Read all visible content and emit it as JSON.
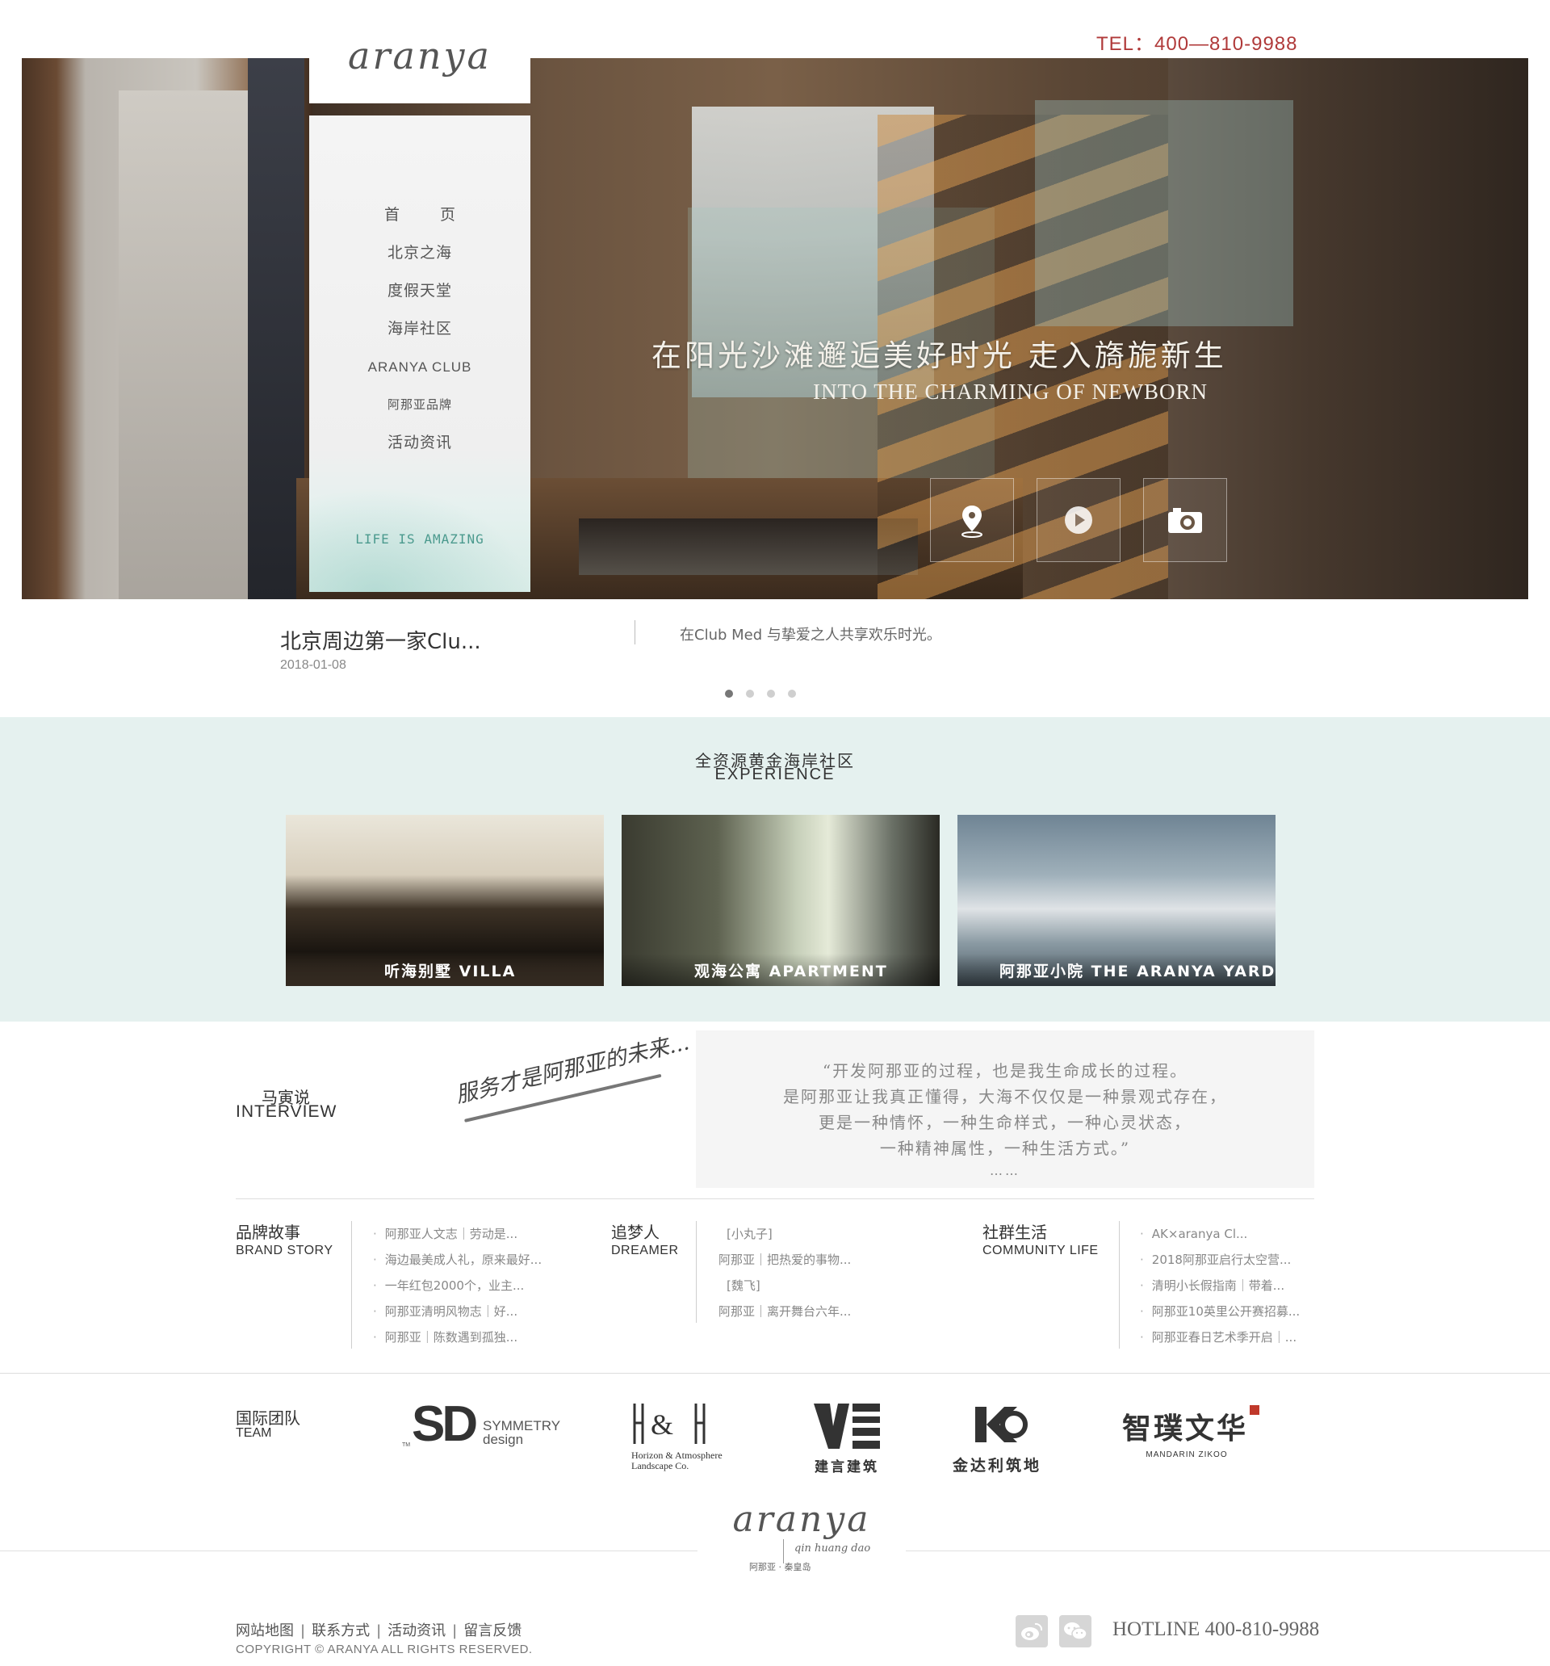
{
  "header": {
    "tel": "TEL：400—810-9988"
  },
  "brand": {
    "logo": "aranya"
  },
  "nav": {
    "items": [
      "首 页",
      "北京之海",
      "度假天堂",
      "海岸社区",
      "ARANYA CLUB",
      "阿那亚品牌",
      "活动资讯"
    ],
    "tagline": "LIFE IS AMAZING"
  },
  "hero": {
    "slogan_cn": "在阳光沙滩邂逅美好时光  走入旖旎新生",
    "slogan_en": "INTO THE CHARMING OF NEWBORN",
    "icons": [
      "location-pin-icon",
      "play-icon",
      "camera-icon"
    ]
  },
  "slide": {
    "title": "北京周边第一家Clu...",
    "date": "2018-01-08",
    "desc": "在Club Med 与挚爱之人共享欢乐时光。",
    "dots_total": 4,
    "active_dot": 1
  },
  "experience": {
    "title_cn": "全资源黄金海岸社区",
    "title_en": "EXPERIENCE",
    "cards": [
      {
        "label": "听海别墅 VILLA"
      },
      {
        "label": "观海公寓 APARTMENT"
      },
      {
        "label": "阿那亚小院  THE ARANYA YARD"
      }
    ]
  },
  "interview": {
    "title_cn": "马寅说",
    "title_en": "INTERVIEW",
    "signature": "服务才是阿那亚的未来...",
    "quote": [
      "“开发阿那亚的过程，也是我生命成长的过程。",
      "是阿那亚让我真正懂得，大海不仅仅是一种景观式存在，",
      "更是一种情怀，一种生命样式，一种心灵状态，",
      "一种精神属性，一种生活方式。”"
    ],
    "ellipsis": "……"
  },
  "columns": {
    "brand_story": {
      "title_cn": "品牌故事",
      "title_en": "BRAND STORY",
      "items": [
        "阿那亚人文志｜劳动是...",
        "海边最美成人礼，原来最好...",
        "一年红包2000个，业主...",
        "阿那亚清明风物志｜好...",
        "阿那亚｜陈数遇到孤独..."
      ]
    },
    "dreamer": {
      "title_cn": "追梦人",
      "title_en": "DREAMER",
      "items": [
        "[小丸子]",
        "阿那亚｜把热爱的事物...",
        "[魏飞]",
        "阿那亚｜离开舞台六年..."
      ]
    },
    "community": {
      "title_cn": "社群生活",
      "title_en": "COMMUNITY LIFE",
      "items": [
        "AK×aranya Cl...",
        "2018阿那亚启行太空营...",
        "清明小长假指南｜带着...",
        "阿那亚10英里公开赛招募...",
        "阿那亚春日艺术季开启｜..."
      ]
    }
  },
  "team": {
    "title_cn": "国际团队",
    "title_en": "TEAM",
    "partners": [
      {
        "mark": "SD",
        "name": "SYMMETRY",
        "sub": "design",
        "tm": "TM"
      },
      {
        "mark": "H&H",
        "name": "Horizon & Atmosphere",
        "sub": "Landscape Co."
      },
      {
        "mark": "V",
        "name": "建言建筑"
      },
      {
        "mark": "K",
        "name": "金达利筑地"
      },
      {
        "mark": "智璞文华",
        "name": "MANDARIN ZIKOO"
      }
    ]
  },
  "footer": {
    "logo": "aranya",
    "logo_sub": "qin huang dao",
    "logo_sub_cn": "阿那亚 · 秦皇岛",
    "links": [
      "网站地图",
      "联系方式",
      "活动资讯",
      "留言反馈"
    ],
    "copyright": "COPYRIGHT © ARANYA ALL RIGHTS  RESERVED.",
    "hotline": "HOTLINE 400-810-9988",
    "social": [
      "weibo-icon",
      "wechat-icon"
    ]
  },
  "colors": {
    "accent_red": "#b03a3a",
    "mint_bg": "#e5f1ef",
    "teal_text": "#4b9a8e"
  }
}
